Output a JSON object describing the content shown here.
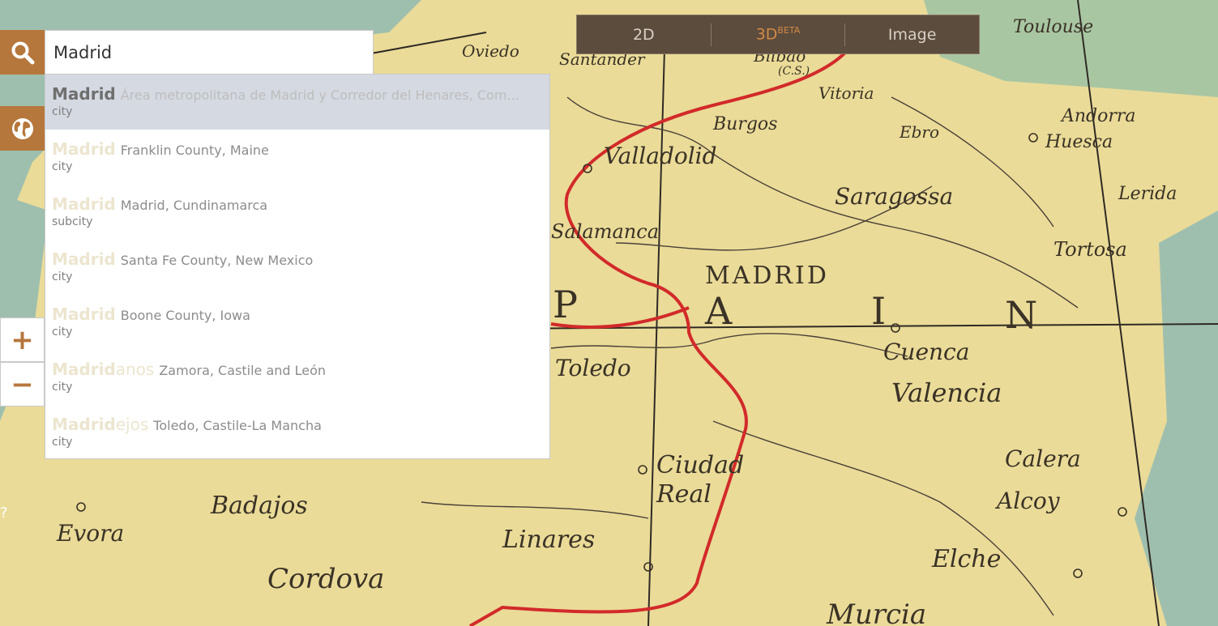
{
  "search": {
    "query": "Madrid",
    "button_icon": "search-icon"
  },
  "globe_button": {
    "icon": "globe-icon"
  },
  "zoom": {
    "in_label": "+",
    "out_label": "−"
  },
  "help_label": "?",
  "view_toggle": {
    "options": [
      {
        "label": "2D",
        "sup": ""
      },
      {
        "label": "3D",
        "sup": "BETA"
      },
      {
        "label": "Image",
        "sup": ""
      }
    ],
    "active": "3D"
  },
  "suggestions": [
    {
      "match": "Madrid",
      "rest": "",
      "region": "Área metropolitana de Madrid y Corredor del Henares, Com…",
      "type": "city"
    },
    {
      "match": "Madrid",
      "rest": "",
      "region": "Franklin County, Maine",
      "type": "city"
    },
    {
      "match": "Madrid",
      "rest": "",
      "region": "Madrid, Cundinamarca",
      "type": "subcity"
    },
    {
      "match": "Madrid",
      "rest": "",
      "region": "Santa Fe County, New Mexico",
      "type": "city"
    },
    {
      "match": "Madrid",
      "rest": "",
      "region": "Boone County, Iowa",
      "type": "city"
    },
    {
      "match": "Madrid",
      "rest": "anos",
      "region": "Zamora, Castile and León",
      "type": "city"
    },
    {
      "match": "Madrid",
      "rest": "ejos",
      "region": "Toledo, Castile-La Mancha",
      "type": "city"
    }
  ],
  "map": {
    "labels": [
      "Toulouse",
      "Oviedo",
      "Santander",
      "Bilbao",
      "(C.S.)",
      "Vitoria",
      "Burgos",
      "Andorra",
      "Huesca",
      "Valladolid",
      "Saragossa",
      "Lerida",
      "Salamanca",
      "Tortosa",
      "MADRID",
      "P",
      "A",
      "I",
      "N",
      "Cuenca",
      "Toledo",
      "Valencia",
      "Ciudad",
      "Real",
      "Calera",
      "Alcoy",
      "Badajos",
      "Evora",
      "Linares",
      "Elche",
      "Cordova",
      "Murcia",
      "Ebro"
    ],
    "colors": {
      "land": "#eadb98",
      "sea": "#9fbfae",
      "route": "#d22a2a",
      "rivers": "#4a4038"
    }
  }
}
